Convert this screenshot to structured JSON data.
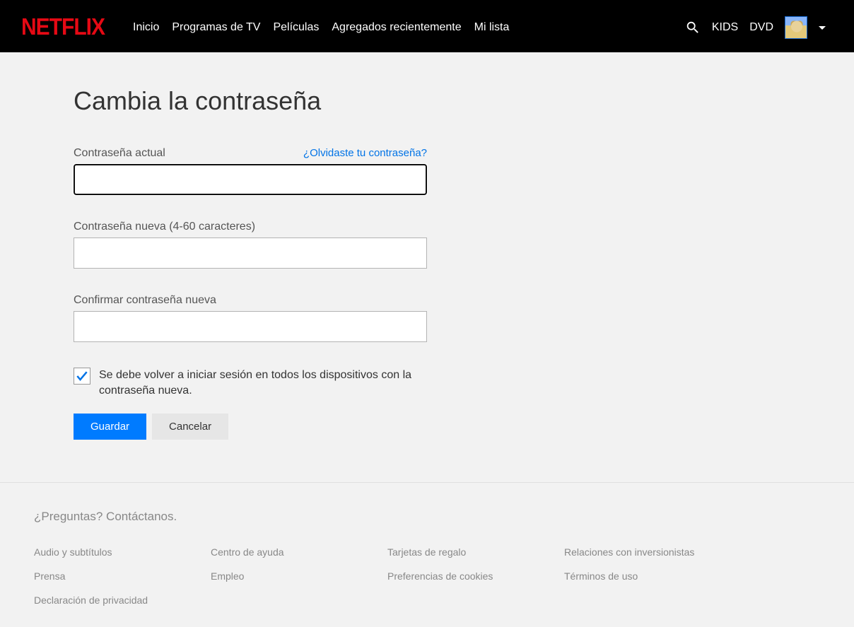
{
  "header": {
    "logo": "NETFLIX",
    "nav": [
      "Inicio",
      "Programas de TV",
      "Películas",
      "Agregados recientemente",
      "Mi lista"
    ],
    "kids": "KIDS",
    "dvd": "DVD"
  },
  "page": {
    "title": "Cambia la contraseña",
    "current_label": "Contraseña actual",
    "forgot": "¿Olvidaste tu contraseña?",
    "new_label": "Contraseña nueva (4-60 caracteres)",
    "confirm_label": "Confirmar contraseña nueva",
    "checkbox_label": "Se debe volver a iniciar sesión en todos los dispositivos con la contraseña nueva.",
    "checkbox_checked": true,
    "save": "Guardar",
    "cancel": "Cancelar"
  },
  "footer": {
    "contact": "¿Preguntas? Contáctanos.",
    "links": [
      "Audio y subtítulos",
      "Centro de ayuda",
      "Tarjetas de regalo",
      "Relaciones con inversionistas",
      "Prensa",
      "Empleo",
      "Preferencias de cookies",
      "Términos de uso",
      "Declaración de privacidad"
    ]
  }
}
